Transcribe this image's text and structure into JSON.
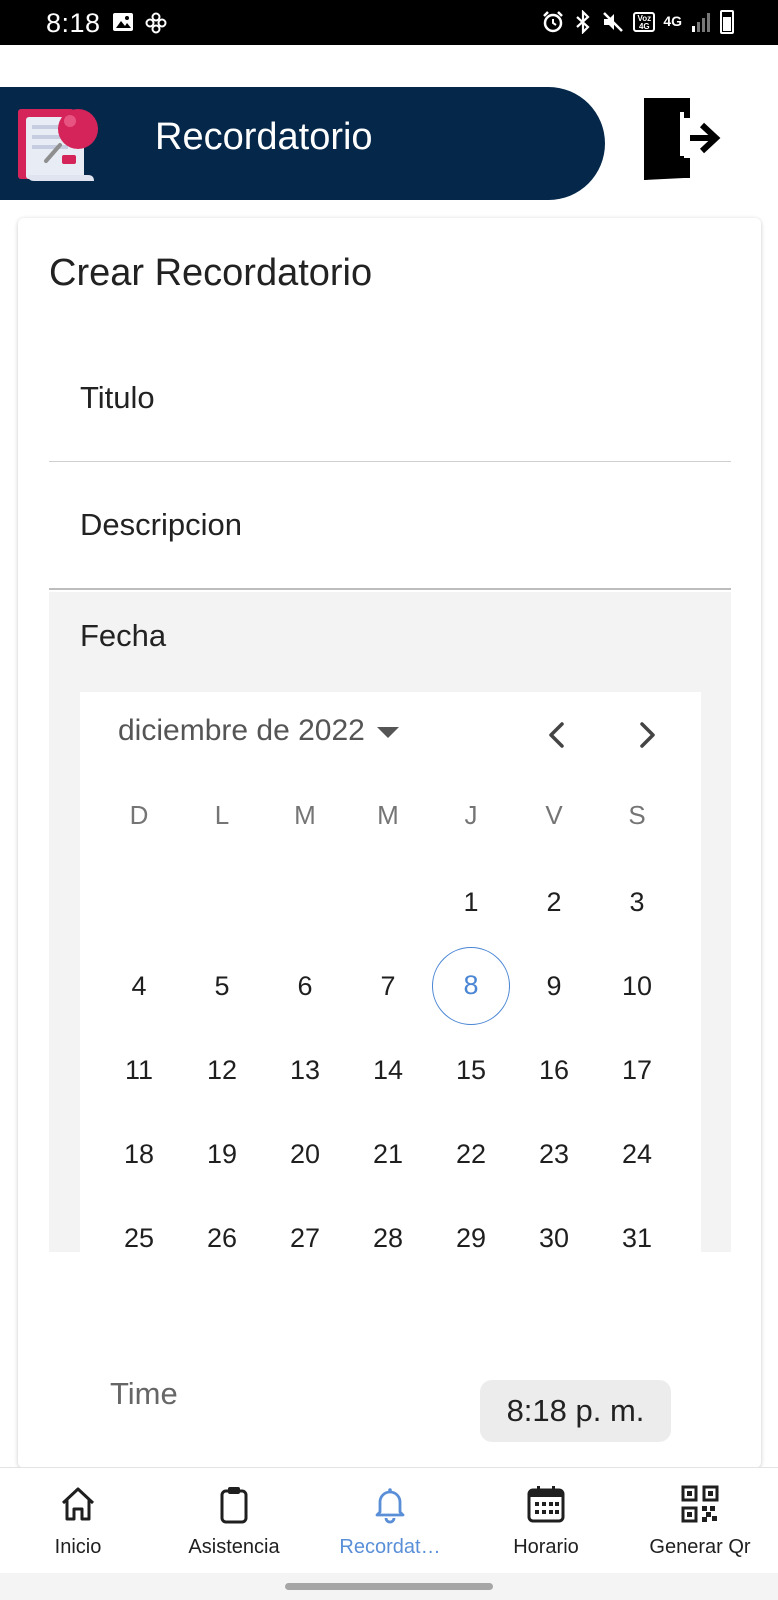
{
  "status_bar": {
    "time": "8:18",
    "left_icons": [
      "image-icon",
      "pinwheel-icon"
    ],
    "right_icons": [
      "alarm-icon",
      "bluetooth-icon",
      "mute-icon",
      "volte-icon",
      "data-4g-icon",
      "signal-icon",
      "battery-icon"
    ],
    "volte_text": "Voz 4G",
    "network": "4G"
  },
  "header": {
    "title": "Recordatorio",
    "logo_icon": "reminder-pin-logo",
    "logout_icon": "logout-door-icon",
    "background_color": "#05284a"
  },
  "form": {
    "heading": "Crear Recordatorio",
    "title_field_label": "Titulo",
    "description_field_label": "Descripcion",
    "date_label": "Fecha",
    "calendar": {
      "month_label": "diciembre de 2022",
      "weekdays": [
        "D",
        "L",
        "M",
        "M",
        "J",
        "V",
        "S"
      ],
      "first_weekday_index": 4,
      "days_in_month": 31,
      "selected_day": 8,
      "accent_color": "#4a86d4"
    },
    "time_label": "Time",
    "time_value": "8:18 p. m."
  },
  "bottom_nav": {
    "items": [
      {
        "label": "Inicio",
        "icon": "home-icon",
        "active": false
      },
      {
        "label": "Asistencia",
        "icon": "clipboard-icon",
        "active": false
      },
      {
        "label": "Recordat…",
        "icon": "bell-icon",
        "active": true
      },
      {
        "label": "Horario",
        "icon": "calendar-grid-icon",
        "active": false
      },
      {
        "label": "Generar Qr",
        "icon": "qr-code-icon",
        "active": false
      }
    ],
    "active_color": "#5a8fd8"
  }
}
